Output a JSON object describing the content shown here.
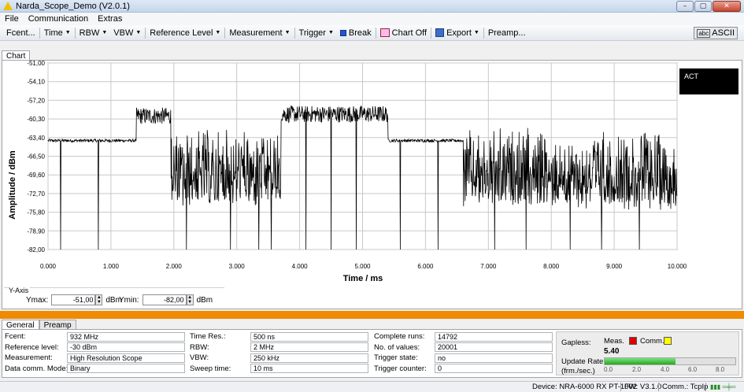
{
  "window": {
    "title": "Narda_Scope_Demo (V2.0.1)",
    "min": "–",
    "max": "▢",
    "close": "✕"
  },
  "menu": [
    "File",
    "Communication",
    "Extras"
  ],
  "toolbar": {
    "fcent": "Fcent...",
    "time": "Time",
    "rbw": "RBW",
    "vbw": "VBW",
    "reflevel": "Reference Level",
    "measurement": "Measurement",
    "trigger": "Trigger",
    "break": "Break",
    "chartoff": "Chart Off",
    "export": "Export",
    "preamp": "Preamp...",
    "ascii": "ASCII",
    "ascii_icon": "abc"
  },
  "tabs": {
    "top": [
      "Chart"
    ],
    "bottom": [
      "General",
      "Preamp"
    ]
  },
  "chart_data": {
    "type": "line",
    "ylabel": "Amplitude / dBm",
    "xlabel": "Time / ms",
    "ylim": [
      -82.0,
      -51.0
    ],
    "xlim": [
      0,
      10
    ],
    "yticks": [
      "-51,00",
      "-54,10",
      "-57,20",
      "-60,30",
      "-63,40",
      "-66,50",
      "-69,60",
      "-72,70",
      "-75,80",
      "-78,90",
      "-82,00"
    ],
    "xticks": [
      "0.000",
      "1.000",
      "2.000",
      "3.000",
      "4.000",
      "5.000",
      "6.000",
      "7.000",
      "8.000",
      "9.000",
      "10.000"
    ],
    "grid": true,
    "segments": [
      {
        "from": 0.0,
        "to": 1.4,
        "level": -63.9,
        "kind": "steady"
      },
      {
        "from": 1.4,
        "to": 1.95,
        "level": -59.8,
        "kind": "dense"
      },
      {
        "from": 1.95,
        "to": 3.7,
        "level": -65.0,
        "kind": "bursty"
      },
      {
        "from": 3.7,
        "to": 5.4,
        "level": -59.5,
        "kind": "dense"
      },
      {
        "from": 5.4,
        "to": 6.6,
        "level": -63.9,
        "kind": "steady"
      },
      {
        "from": 6.6,
        "to": 10.0,
        "level": -65.0,
        "kind": "bursty"
      }
    ],
    "dropouts": [
      0.2,
      0.8,
      2.2,
      2.9,
      3.35,
      3.55,
      4.1,
      4.5,
      4.9,
      5.6,
      6.2,
      7.1,
      7.6,
      8.3,
      8.8,
      9.4
    ]
  },
  "act_label": "ACT",
  "yaxis": {
    "group": "Y-Axis",
    "ymax_label": "Ymax:",
    "ymax": "-51,00",
    "ymin_label": "Ymin:",
    "ymin": "-82,00",
    "unit": "dBm"
  },
  "general": {
    "col1": [
      {
        "k": "Fcent:",
        "v": "932 MHz"
      },
      {
        "k": "Reference level:",
        "v": "-30 dBm"
      },
      {
        "k": "Measurement:",
        "v": "High Resolution Scope"
      },
      {
        "k": "Data comm. Mode:",
        "v": "Binary"
      }
    ],
    "col2": [
      {
        "k": "Time Res.:",
        "v": "500 ns"
      },
      {
        "k": "RBW:",
        "v": "2 MHz"
      },
      {
        "k": "VBW:",
        "v": "250 kHz"
      },
      {
        "k": "Sweep time:",
        "v": "10 ms"
      }
    ],
    "col3": [
      {
        "k": "Complete runs:",
        "v": "14792"
      },
      {
        "k": "No. of values:",
        "v": "20001"
      },
      {
        "k": "Trigger state:",
        "v": "no"
      },
      {
        "k": "Trigger counter:",
        "v": "0"
      }
    ]
  },
  "status": {
    "gapless": "Gapless:",
    "meas": "Meas.",
    "comm": "Comm.",
    "rate_value": "5.40",
    "update_rate": "Update Rate:",
    "frm": "(frm./sec.)",
    "meas_color": "#e00000",
    "comm_color": "#ffff00",
    "progress": 0.54,
    "ticks": [
      "0.0",
      "2.0",
      "4.0",
      "6.0",
      "8.0"
    ]
  },
  "statusbar": {
    "device": "Device: NRA-6000 RX PT-1002",
    "fw": "FW: V3.1.0",
    "comm": "Comm.: TcpIp"
  }
}
